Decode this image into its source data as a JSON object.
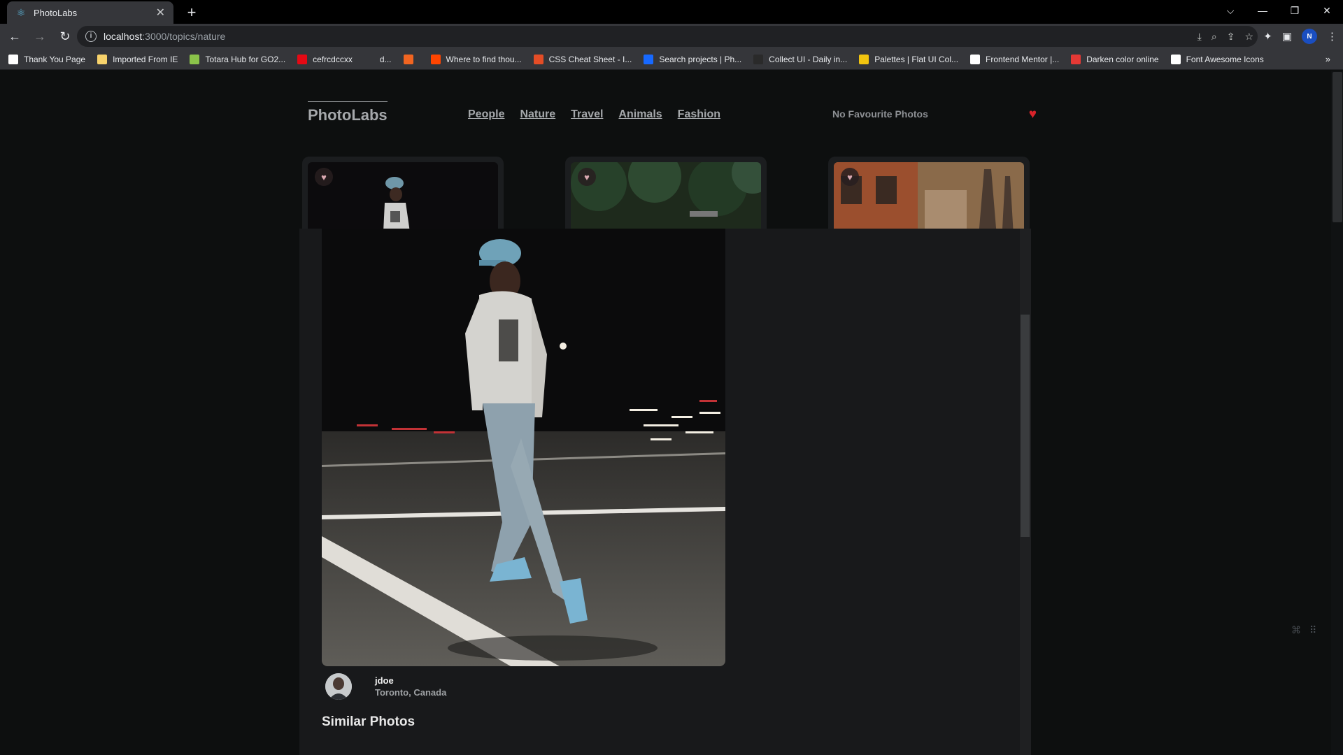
{
  "browser": {
    "tab_title": "PhotoLabs",
    "tab_close": "✕",
    "new_tab": "+",
    "url_host": "localhost",
    "url_path": ":3000/topics/nature",
    "profile_initial": "N",
    "bookmarks": [
      {
        "label": "Thank You Page",
        "icon": "github-icon",
        "color": "#ffffff"
      },
      {
        "label": "Imported From IE",
        "icon": "folder-icon",
        "color": "#f7d26b"
      },
      {
        "label": "Totara Hub for GO2...",
        "icon": "totara-icon",
        "color": "#8bc34a"
      },
      {
        "label": "cefrcdccxx",
        "icon": "netflix-icon",
        "color": "#e50914"
      },
      {
        "label": "d...",
        "icon": "blank-icon",
        "color": "#35363a"
      },
      {
        "label": "",
        "icon": "etsy-icon",
        "color": "#f16521"
      },
      {
        "label": "Where to find thou...",
        "icon": "reddit-icon",
        "color": "#ff4500"
      },
      {
        "label": "CSS Cheat Sheet - I...",
        "icon": "css-icon",
        "color": "#e44d26"
      },
      {
        "label": "Search projects | Ph...",
        "icon": "behance-icon",
        "color": "#1769ff"
      },
      {
        "label": "Collect UI - Daily in...",
        "icon": "collectui-icon",
        "color": "#2a2a2a"
      },
      {
        "label": "Palettes | Flat UI Col...",
        "icon": "palette-icon",
        "color": "#f1c40f"
      },
      {
        "label": "Frontend Mentor |...",
        "icon": "frontendmentor-icon",
        "color": "#ffffff"
      },
      {
        "label": "Darken color online",
        "icon": "darken-icon",
        "color": "#e53935"
      },
      {
        "label": "Font Awesome Icons",
        "icon": "fontawesome-icon",
        "color": "#ffffff"
      }
    ]
  },
  "app": {
    "logo": "PhotoLabs",
    "topics": [
      "People",
      "Nature",
      "Travel",
      "Animals",
      "Fashion"
    ],
    "favourites_text": "No Favourite Photos",
    "accent": "#d8232a"
  },
  "modal": {
    "owner_name": "jdoe",
    "owner_location": "Toronto, Canada",
    "similar_heading": "Similar Photos"
  }
}
